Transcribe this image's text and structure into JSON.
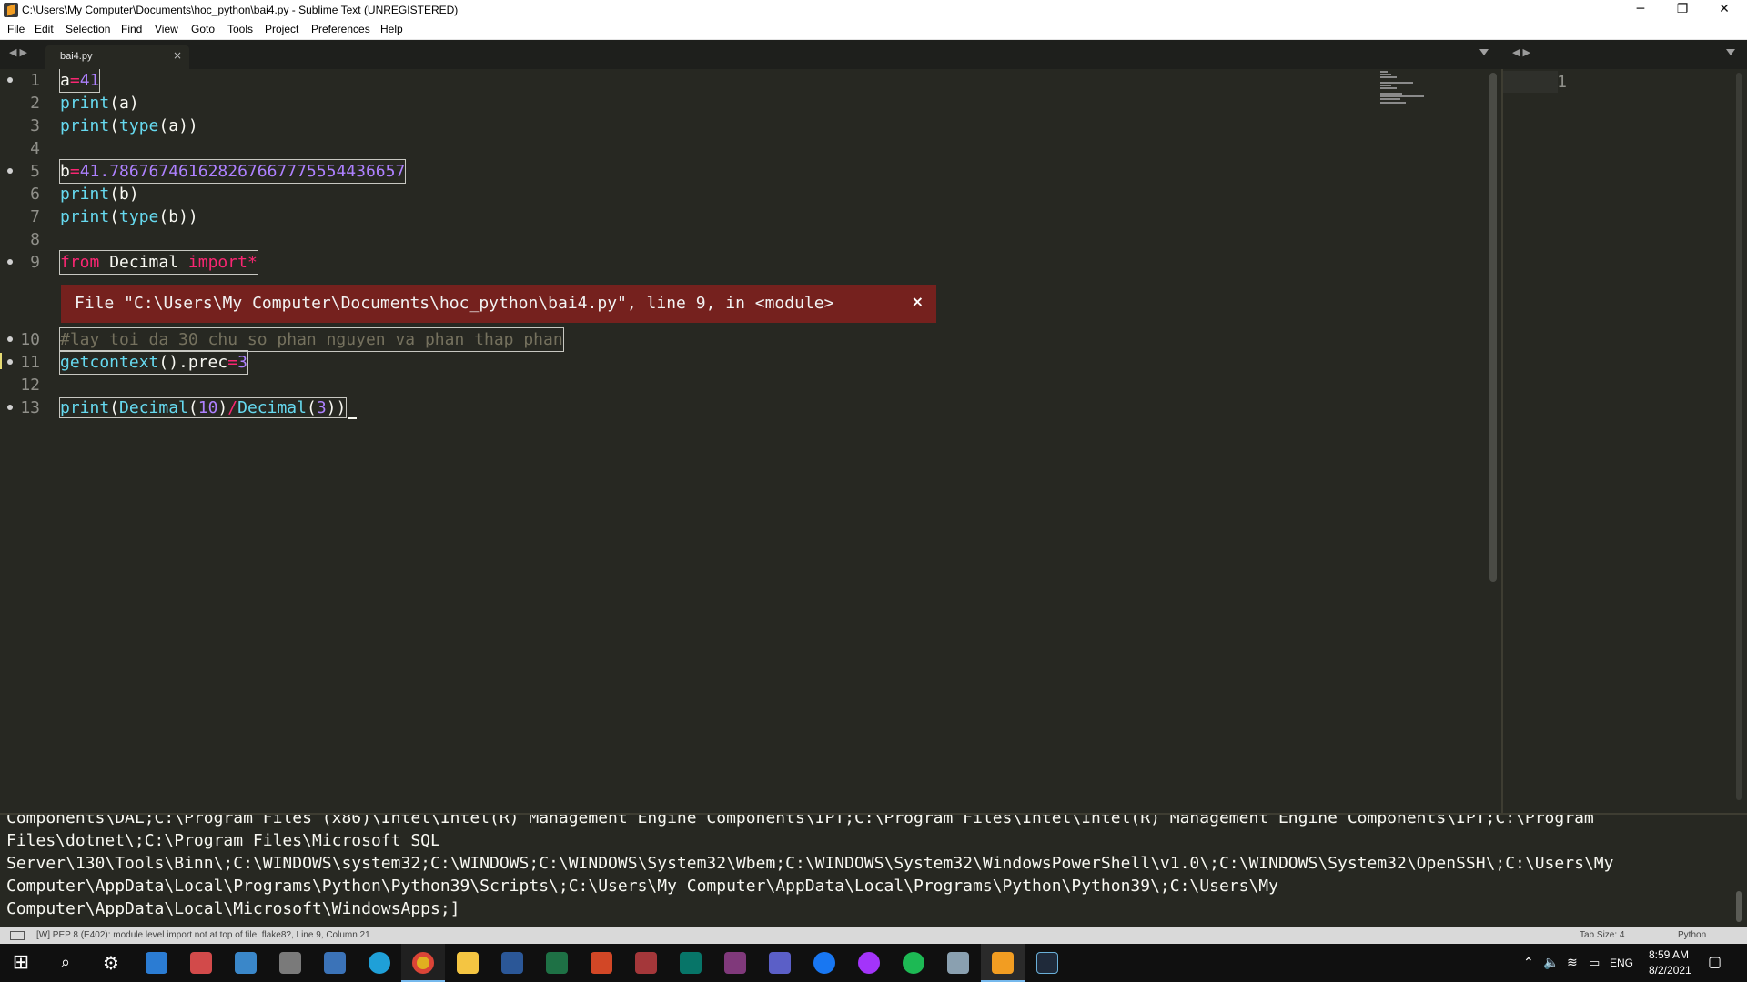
{
  "window": {
    "title": "C:\\Users\\My Computer\\Documents\\hoc_python\\bai4.py - Sublime Text (UNREGISTERED)",
    "controls": {
      "minimize": "─",
      "maximize": "❐",
      "close": "✕"
    }
  },
  "menu": [
    "File",
    "Edit",
    "Selection",
    "Find",
    "View",
    "Goto",
    "Tools",
    "Project",
    "Preferences",
    "Help"
  ],
  "tabs": [
    {
      "label": "bai4.py",
      "close": "×",
      "active": true
    }
  ],
  "editor": {
    "lines": [
      {
        "n": "1",
        "dirty": true
      },
      {
        "n": "2"
      },
      {
        "n": "3"
      },
      {
        "n": "4"
      },
      {
        "n": "5",
        "dirty": true
      },
      {
        "n": "6"
      },
      {
        "n": "7"
      },
      {
        "n": "8"
      },
      {
        "n": "9",
        "dirty": true
      },
      {
        "n": "10",
        "dirty": true
      },
      {
        "n": "11",
        "dirty": true
      },
      {
        "n": "12"
      },
      {
        "n": "13",
        "dirty": true
      }
    ],
    "code": {
      "l1": {
        "a": "a",
        "eq": "=",
        "v": "41"
      },
      "l2": {
        "fn": "print",
        "rest": "(a)"
      },
      "l3": {
        "fn": "print",
        "p1": "(",
        "fn2": "type",
        "p2": "(a))"
      },
      "l5": {
        "b": "b",
        "eq": "=",
        "v": "41.786767461628267667775554436657"
      },
      "l6": {
        "fn": "print",
        "rest": "(b)"
      },
      "l7": {
        "fn": "print",
        "p1": "(",
        "fn2": "type",
        "p2": "(b))"
      },
      "l9": {
        "kw1": "from",
        "mod": " Decimal ",
        "kw2": "import",
        "star": "*"
      },
      "l10": {
        "comment": "#lay toi da 30 chu so phan nguyen va phan thap phan"
      },
      "l11": {
        "fn": "getcontext",
        "mid": "().prec",
        "eq": "=",
        "v": "3"
      },
      "l13": {
        "fn": "print",
        "p1": "(",
        "c1": "Decimal",
        "p2": "(",
        "n1": "10",
        "p3": ")",
        "op": "/",
        "c2": "Decimal",
        "p4": "(",
        "n2": "3",
        "p5": "))"
      }
    },
    "error": {
      "text": "File \"C:\\Users\\My Computer\\Documents\\hoc_python\\bai4.py\", line 9, in <module>",
      "close": "×"
    }
  },
  "second_pane": {
    "line": "1"
  },
  "output": {
    "lines": [
      "Components\\DAL;C:\\Program Files (x86)\\Intel\\Intel(R) Management Engine Components\\IPT;C:\\Program Files\\Intel\\Intel(R) Management Engine Components\\IPT;C:\\Program",
      "Files\\dotnet\\;C:\\Program Files\\Microsoft SQL",
      "Server\\130\\Tools\\Binn\\;C:\\WINDOWS\\system32;C:\\WINDOWS;C:\\WINDOWS\\System32\\Wbem;C:\\WINDOWS\\System32\\WindowsPowerShell\\v1.0\\;C:\\WINDOWS\\System32\\OpenSSH\\;C:\\Users\\My",
      "Computer\\AppData\\Local\\Programs\\Python\\Python39\\Scripts\\;C:\\Users\\My Computer\\AppData\\Local\\Programs\\Python\\Python39\\;C:\\Users\\My",
      "Computer\\AppData\\Local\\Microsoft\\WindowsApps;]"
    ]
  },
  "status": {
    "message": "[W] PEP 8 (E402): module level import not at top of file, flake8?, Line 9, Column 21",
    "tab_size": "Tab Size: 4",
    "syntax": "Python"
  },
  "taskbar": {
    "apps": [
      "windows-start",
      "search",
      "settings",
      "store",
      "tool",
      "photos",
      "scanner",
      "network",
      "edge",
      "chrome",
      "explorer",
      "word",
      "excel",
      "powerpoint",
      "access",
      "publisher",
      "onenote",
      "teams",
      "facebook",
      "messenger",
      "spotify",
      "game",
      "sublime-text",
      "nox"
    ],
    "tray": {
      "lang": "ENG",
      "time": "8:59 AM",
      "date": "8/2/2021"
    }
  },
  "colors": {
    "editor_bg": "#272822",
    "keyword": "#f92672",
    "number": "#ae81ff",
    "function": "#66d9ef",
    "comment": "#75715e",
    "error_bg": "#75211e"
  }
}
